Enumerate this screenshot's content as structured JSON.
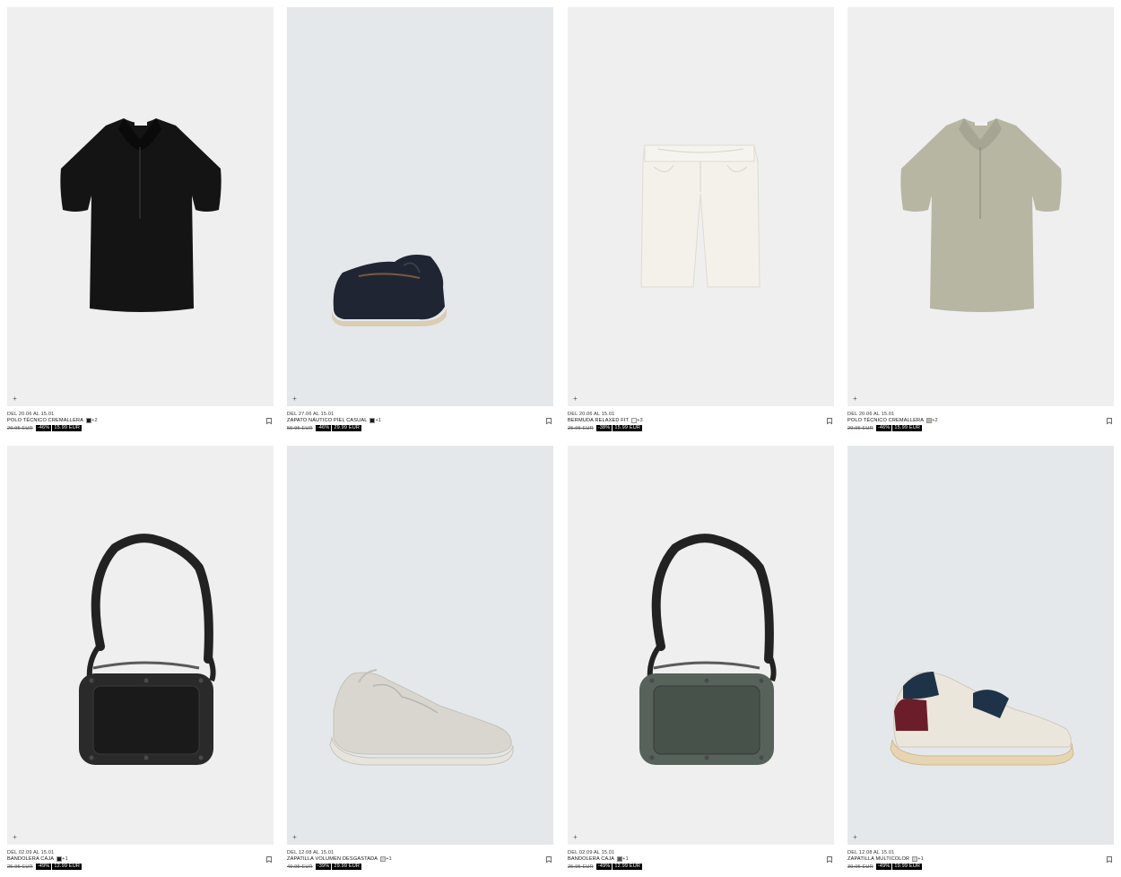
{
  "products": [
    {
      "dates": "DEL 20.06 AL 15.01",
      "name": "POLO TÉCNICO CREMALLERA",
      "more": "+2",
      "swatch": "#1a1a1a",
      "old_price": "29.95 EUR",
      "discount": "-46%",
      "price": "15.99 EUR",
      "bg": "#efefef",
      "art": "polo-black"
    },
    {
      "dates": "DEL 27.06 AL 15.01",
      "name": "ZAPATO NÁUTICO PIEL CASUAL",
      "more": "+1",
      "swatch": "#1a1a1a",
      "old_price": "55.95 EUR",
      "discount": "-46%",
      "price": "29.99 EUR",
      "bg": "#e5e8ea",
      "art": "boat-shoe"
    },
    {
      "dates": "DEL 20.06 AL 15.01",
      "name": "BERMUDA RELAXED FIT",
      "more": "+3",
      "swatch": "#f4f1e8",
      "old_price": "25.95 EUR",
      "discount": "-38%",
      "price": "15.99 EUR",
      "bg": "#efefef",
      "art": "shorts"
    },
    {
      "dates": "DEL 20.06 AL 15.01",
      "name": "POLO TÉCNICO CREMALLERA",
      "more": "+2",
      "swatch": "#b8b8a6",
      "old_price": "29.95 EUR",
      "discount": "-46%",
      "price": "15.99 EUR",
      "bg": "#efefef",
      "art": "polo-sage"
    },
    {
      "dates": "DEL 02.09 AL 15.01",
      "name": "BANDOLERA CAJA",
      "more": "+1",
      "swatch": "#1a1a1a",
      "old_price": "25.95 EUR",
      "discount": "-49%",
      "price": "12.99 EUR",
      "bg": "#efefef",
      "art": "bag-black"
    },
    {
      "dates": "DEL 12.08 AL 15.01",
      "name": "ZAPATILLA VOLUMEN DESGASTADA",
      "more": "+1",
      "swatch": "#d6d4cc",
      "old_price": "49.95 EUR",
      "discount": "-39%",
      "price": "29.99 EUR",
      "bg": "#e5e8ea",
      "art": "sneaker-grey"
    },
    {
      "dates": "DEL 02.09 AL 15.01",
      "name": "BANDOLERA CAJA",
      "more": "+1",
      "swatch": "#4f5a50",
      "old_price": "25.95 EUR",
      "discount": "-49%",
      "price": "12.99 EUR",
      "bg": "#efefef",
      "art": "bag-green"
    },
    {
      "dates": "DEL 12.08 AL 15.01",
      "name": "ZAPATILLA MULTICOLOR",
      "more": "+1",
      "swatch": "#d6d4cc",
      "old_price": "39.95 EUR",
      "discount": "-49%",
      "price": "19.99 EUR",
      "bg": "#e5e8ea",
      "art": "sneaker-multi"
    }
  ],
  "ui": {
    "add_symbol": "+"
  }
}
